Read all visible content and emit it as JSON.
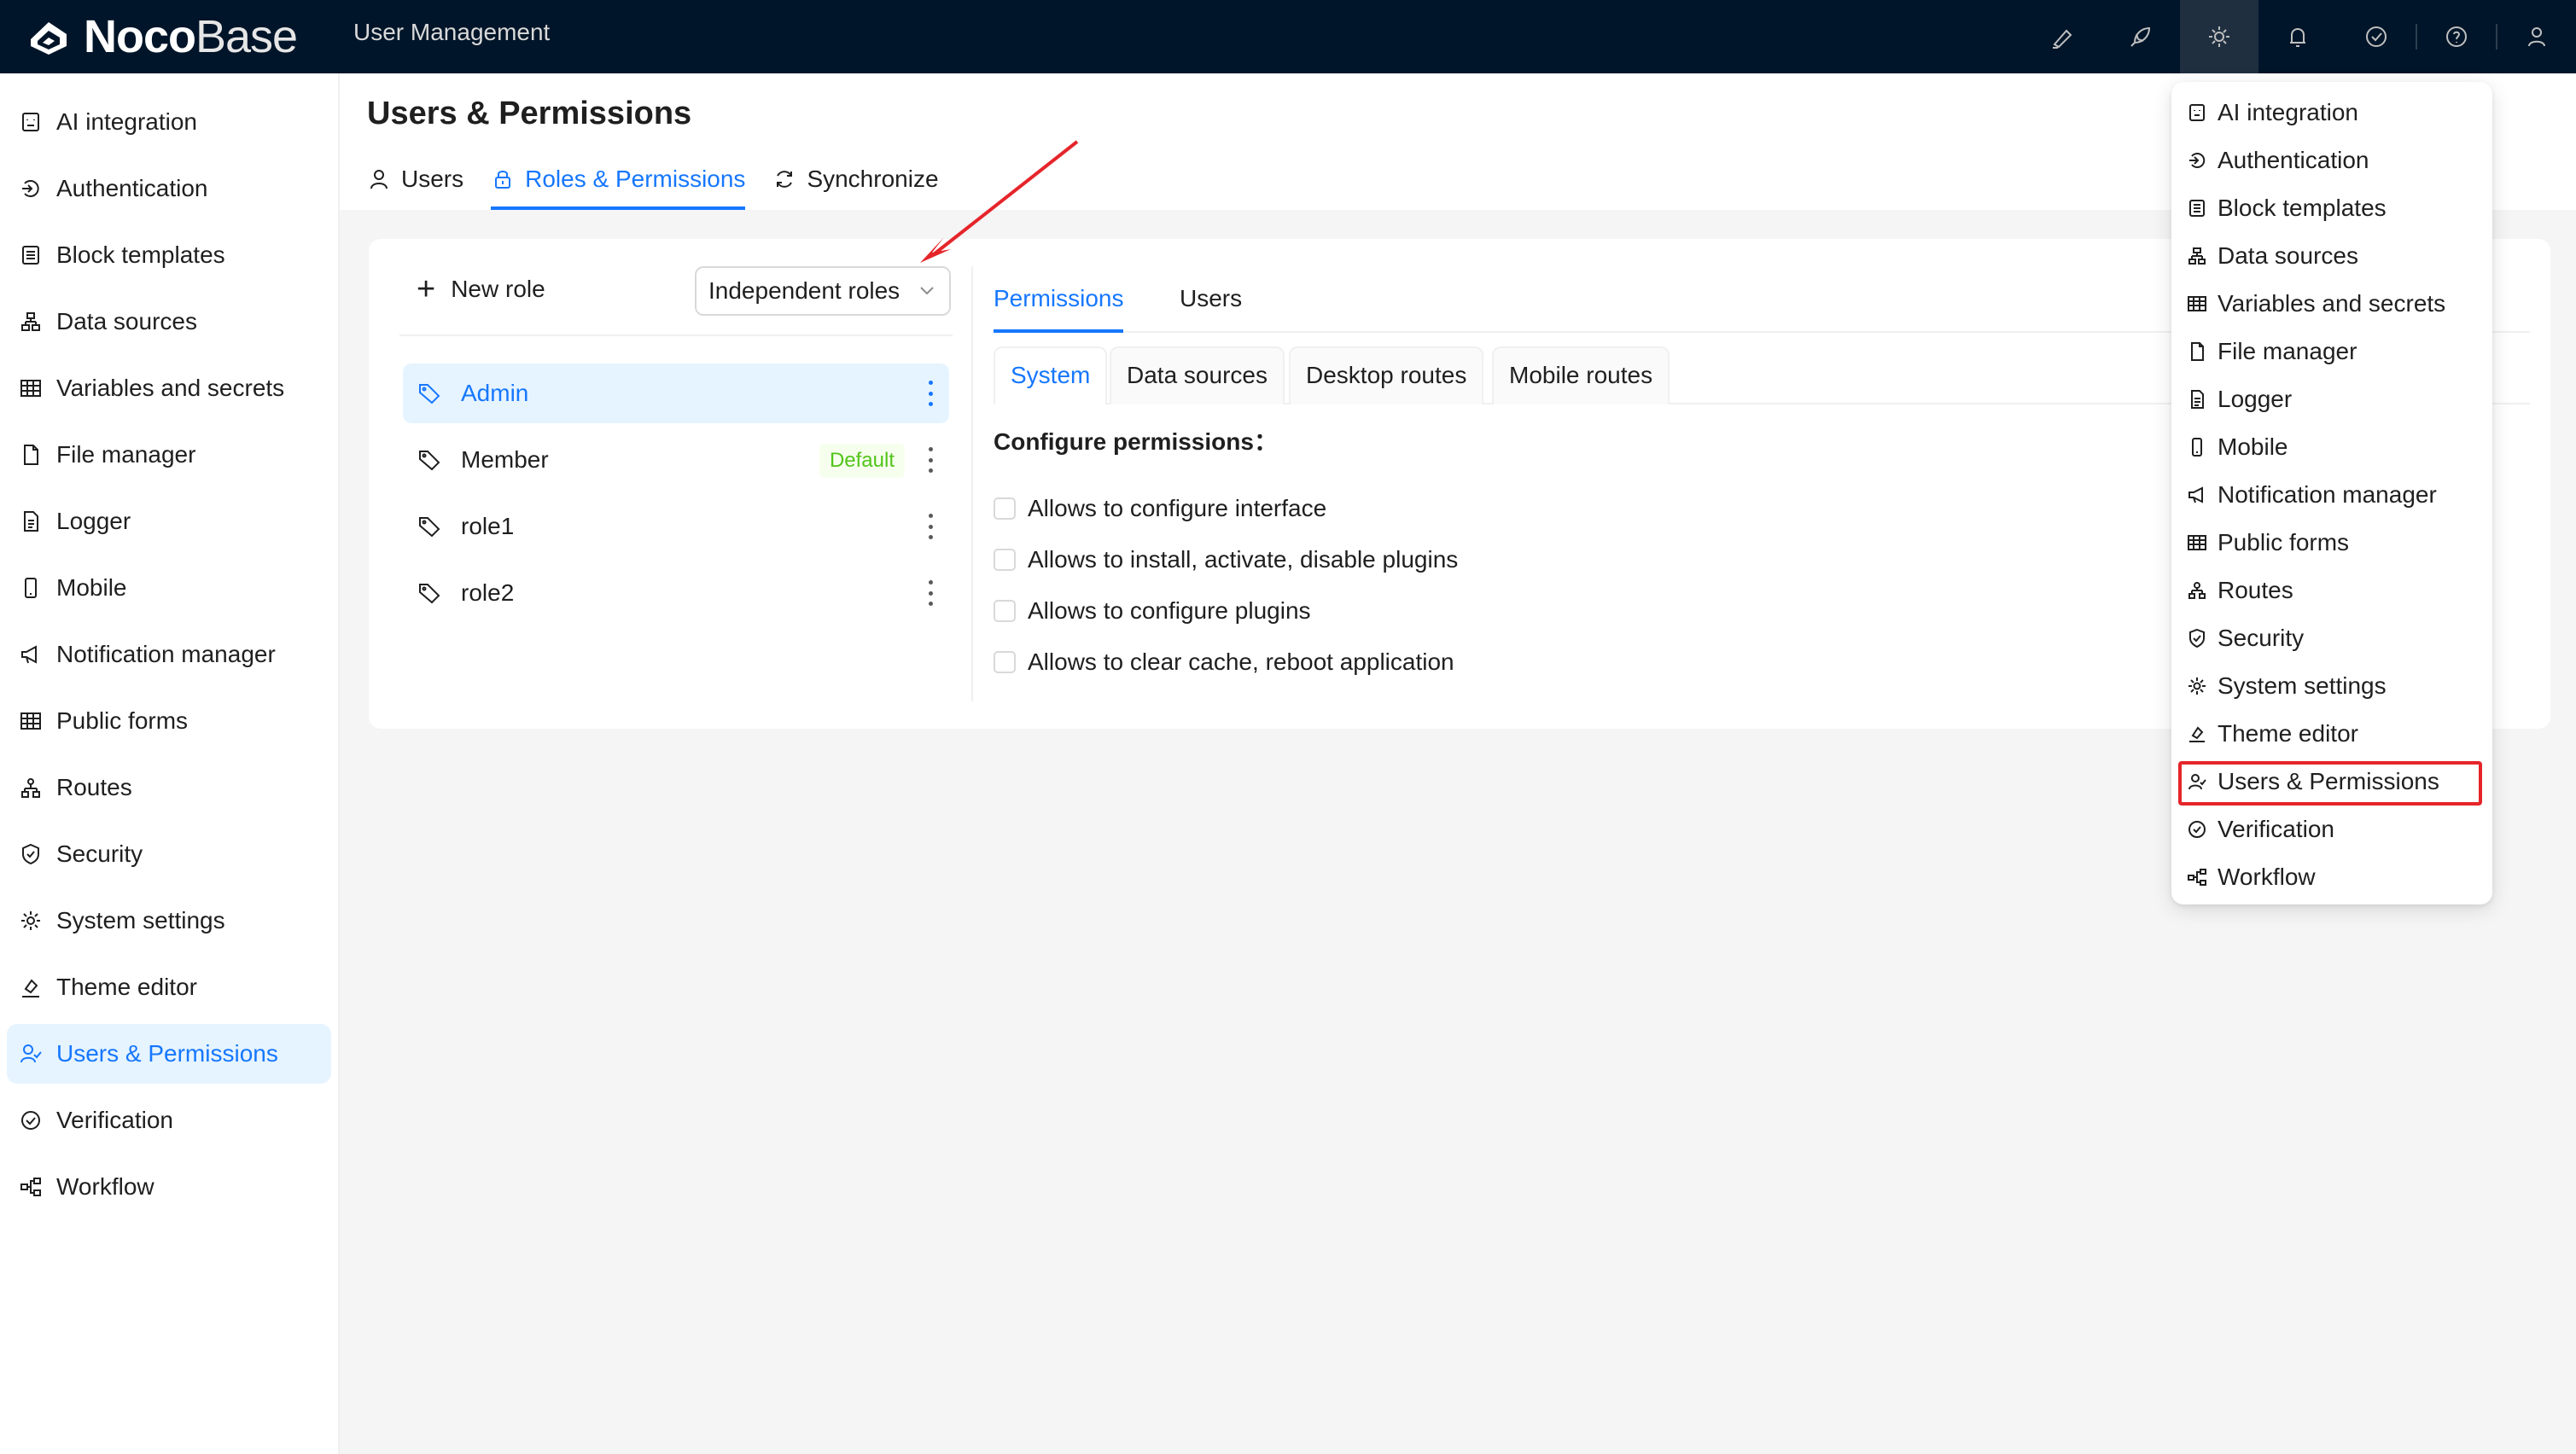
{
  "app": {
    "logo_bold": "Noco",
    "logo_light": "Base",
    "title": "User Management"
  },
  "top_icons": [
    "highlighter-icon",
    "rocket-icon",
    "gear-icon",
    "bell-icon",
    "check-circle-icon",
    "question-icon",
    "user-icon"
  ],
  "sidebar": {
    "items": [
      {
        "label": "AI integration",
        "icon": "robot-icon"
      },
      {
        "label": "Authentication",
        "icon": "login-icon"
      },
      {
        "label": "Block templates",
        "icon": "layout-icon"
      },
      {
        "label": "Data sources",
        "icon": "cluster-icon"
      },
      {
        "label": "Variables and secrets",
        "icon": "table-icon"
      },
      {
        "label": "File manager",
        "icon": "file-icon"
      },
      {
        "label": "Logger",
        "icon": "file-text-icon"
      },
      {
        "label": "Mobile",
        "icon": "mobile-icon"
      },
      {
        "label": "Notification manager",
        "icon": "notification-icon"
      },
      {
        "label": "Public forms",
        "icon": "table-icon"
      },
      {
        "label": "Routes",
        "icon": "apartment-icon"
      },
      {
        "label": "Security",
        "icon": "shield-icon"
      },
      {
        "label": "System settings",
        "icon": "gear-icon"
      },
      {
        "label": "Theme editor",
        "icon": "bg-colors-icon"
      },
      {
        "label": "Users & Permissions",
        "icon": "users-icon",
        "active": true
      },
      {
        "label": "Verification",
        "icon": "check-circle-icon"
      },
      {
        "label": "Workflow",
        "icon": "workflow-icon"
      }
    ]
  },
  "page": {
    "title": "Users & Permissions",
    "tabs": [
      {
        "label": "Users",
        "icon": "user-icon"
      },
      {
        "label": "Roles & Permissions",
        "icon": "lock-icon",
        "active": true
      },
      {
        "label": "Synchronize",
        "icon": "sync-icon"
      }
    ]
  },
  "roles": {
    "new_role_label": "New role",
    "mode_select": "Independent roles",
    "list": [
      {
        "name": "Admin",
        "active": true
      },
      {
        "name": "Member",
        "badge": "Default"
      },
      {
        "name": "role1"
      },
      {
        "name": "role2"
      }
    ]
  },
  "permissions": {
    "tabs": [
      "Permissions",
      "Users"
    ],
    "sub_tabs": [
      "System",
      "Data sources",
      "Desktop routes",
      "Mobile routes"
    ],
    "config_label": "Configure permissions：",
    "checks": [
      "Allows to configure interface",
      "Allows to install, activate, disable plugins",
      "Allows to configure plugins",
      "Allows to clear cache, reboot application"
    ]
  },
  "settings_menu": {
    "items": [
      "AI integration",
      "Authentication",
      "Block templates",
      "Data sources",
      "Variables and secrets",
      "File manager",
      "Logger",
      "Mobile",
      "Notification manager",
      "Public forms",
      "Routes",
      "Security",
      "System settings",
      "Theme editor",
      "Users & Permissions",
      "Verification",
      "Workflow"
    ],
    "highlighted": "Users & Permissions"
  },
  "colors": {
    "topbar": "#001529",
    "accent": "#1677ff",
    "highlight_box": "#e5252a",
    "badge_green": "#52c41a"
  }
}
